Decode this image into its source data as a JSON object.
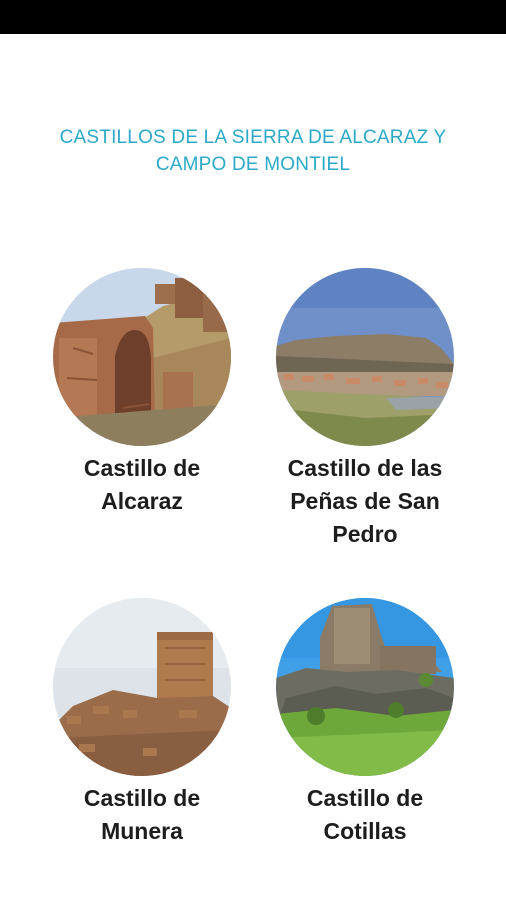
{
  "header": {
    "title_line1": "CASTILLOS DE LA SIERRA DE ALCARAZ Y",
    "title_line2": "CAMPO DE MONTIEL",
    "color": "#2aa9c9"
  },
  "castles": [
    {
      "image": "castle-ruins-arch-photo",
      "label_line1": "Castillo de",
      "label_line2": "Alcaraz",
      "label_line3": ""
    },
    {
      "image": "cliff-town-landscape-photo",
      "label_line1": "Castillo de las",
      "label_line2": "Peñas de San",
      "label_line3": "Pedro"
    },
    {
      "image": "stone-tower-ruins-photo",
      "label_line1": "Castillo de",
      "label_line2": "Munera",
      "label_line3": ""
    },
    {
      "image": "hilltop-castle-photo",
      "label_line1": "Castillo de",
      "label_line2": "Cotillas",
      "label_line3": ""
    }
  ]
}
